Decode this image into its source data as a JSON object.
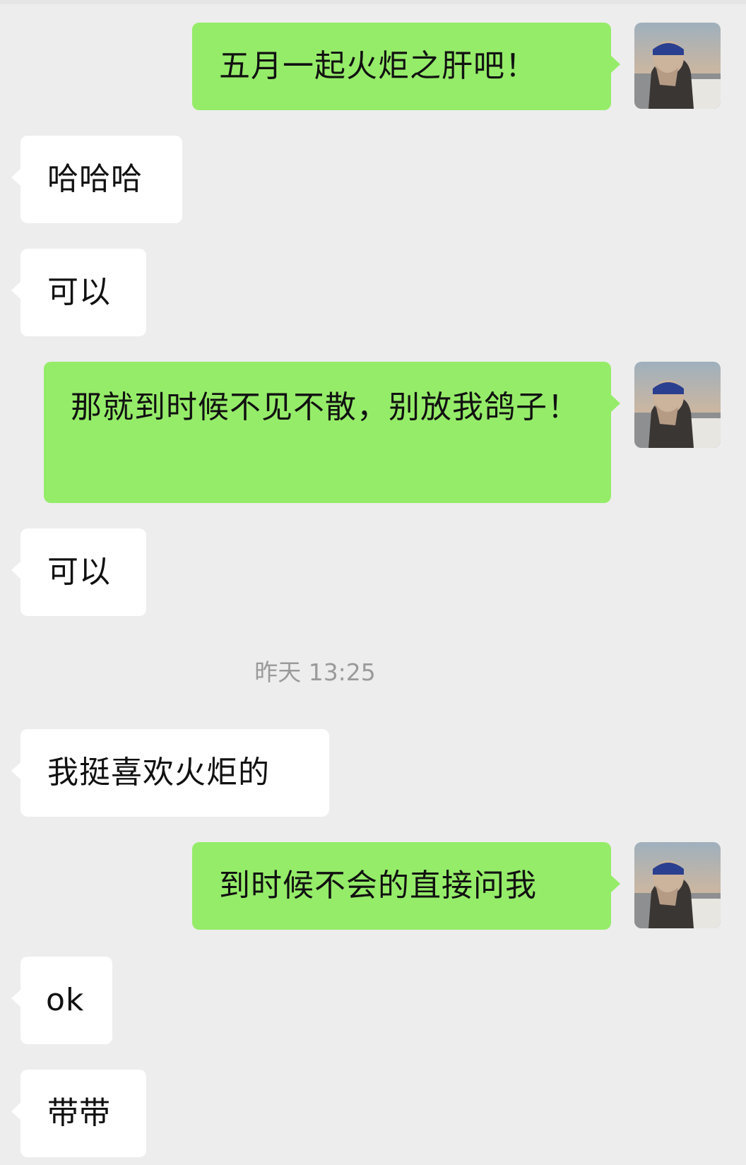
{
  "chat": {
    "messages": [
      {
        "side": "out",
        "text": "五月一起火炬之肝吧！"
      },
      {
        "side": "in",
        "text": "哈哈哈"
      },
      {
        "side": "in",
        "text": "可以"
      },
      {
        "side": "out",
        "text": "那就到时候不见不散，别放我鸽子！"
      },
      {
        "side": "in",
        "text": "可以"
      },
      {
        "side": "in",
        "text": "我挺喜欢火炬的"
      },
      {
        "side": "out",
        "text": "到时候不会的直接问我"
      },
      {
        "side": "in",
        "text": "ok"
      },
      {
        "side": "in",
        "text": "带带"
      }
    ],
    "timestamp": "昨天 13:25",
    "avatar_icon": "user-avatar-icon"
  },
  "colors": {
    "background": "#ededed",
    "outgoing_bubble": "#95ec69",
    "incoming_bubble": "#ffffff",
    "timestamp_text": "#9a9a9a"
  }
}
